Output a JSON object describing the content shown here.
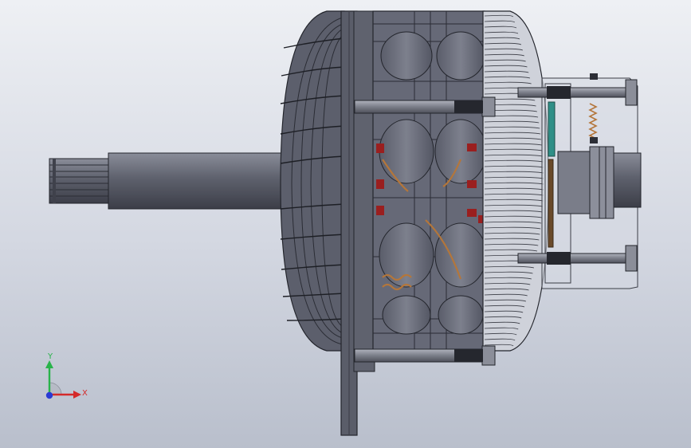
{
  "viewport": {
    "background_top": "#eef0f4",
    "background_bottom": "#b9bfcc"
  },
  "model": {
    "part": "alternator-assembly",
    "body_color": "#5c5f6c",
    "edge_color": "#23252c",
    "shaft_color": "#60636f",
    "winding_color": "#9a1f1f",
    "spring_color": "#b4763a",
    "clip_color": "#2f8f87"
  },
  "triad": {
    "x_label": "X",
    "y_label": "Y",
    "x_color": "#d42a2a",
    "y_color": "#29b34a",
    "z_color": "#2a3bd4"
  }
}
